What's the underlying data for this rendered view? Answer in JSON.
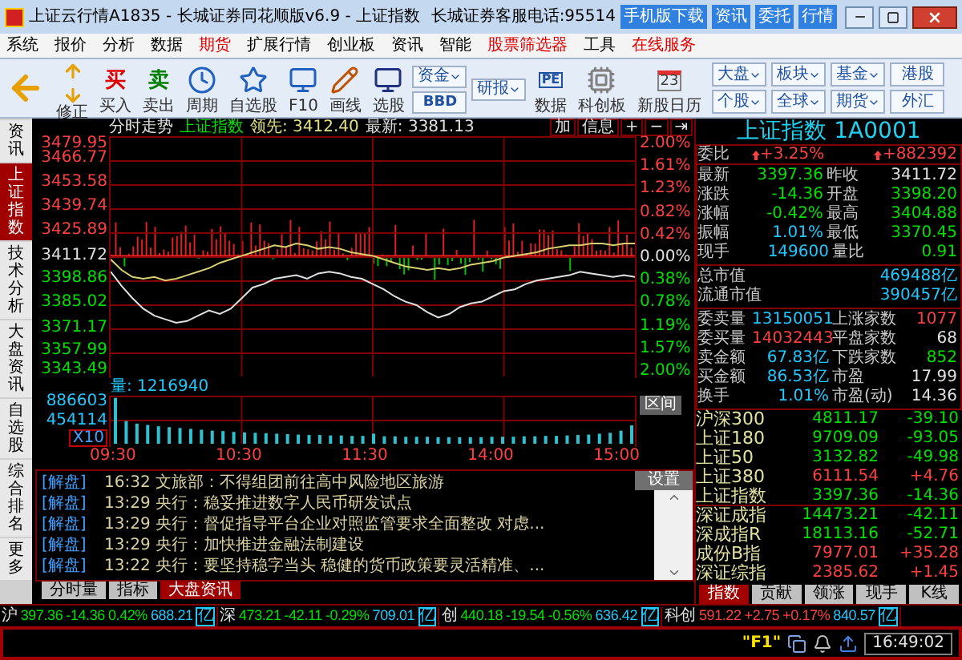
{
  "window": {
    "title": "上证云行情A1835 - 长城证券同花顺版v6.9 - 上证指数",
    "hotline": "长城证券客服电话:95514",
    "buttons": [
      "手机版下载",
      "资讯",
      "委托",
      "行情"
    ]
  },
  "menu": [
    {
      "label": "系统",
      "highlight": false
    },
    {
      "label": "报价",
      "highlight": false
    },
    {
      "label": "分析",
      "highlight": false
    },
    {
      "label": "数据",
      "highlight": false
    },
    {
      "label": "期货",
      "highlight": true
    },
    {
      "label": "扩展行情",
      "highlight": false
    },
    {
      "label": "创业板",
      "highlight": false
    },
    {
      "label": "资讯",
      "highlight": false
    },
    {
      "label": "智能",
      "highlight": false
    },
    {
      "label": "股票筛选器",
      "highlight": true
    },
    {
      "label": "工具",
      "highlight": false
    },
    {
      "label": "在线服务",
      "highlight": true
    }
  ],
  "toolbar": {
    "tools": [
      {
        "kind": "back"
      },
      {
        "kind": "updown",
        "label": "修正"
      },
      {
        "kind": "buy",
        "glyph": "买",
        "label": "买入"
      },
      {
        "kind": "sell",
        "glyph": "卖",
        "label": "卖出"
      },
      {
        "kind": "clock",
        "label": "周期"
      },
      {
        "kind": "folder",
        "label": "自选股"
      },
      {
        "kind": "monitor",
        "label": "F10"
      },
      {
        "kind": "pencil",
        "label": "画线"
      },
      {
        "kind": "screen",
        "label": "选股"
      },
      {
        "kind": "pair",
        "top": "资金",
        "bottom": "BBD"
      },
      {
        "kind": "single",
        "top": "研报"
      },
      {
        "kind": "doc",
        "glyph": "PE",
        "label": "数据"
      },
      {
        "kind": "chip",
        "label": "科创板"
      },
      {
        "kind": "calendar",
        "glyph": "23",
        "label": "新股日历"
      }
    ],
    "markets": [
      {
        "label": "大盘",
        "dropdown": true
      },
      {
        "label": "板块",
        "dropdown": true
      },
      {
        "label": "基金",
        "dropdown": true
      },
      {
        "label": "港股",
        "dropdown": false
      },
      {
        "label": "个股",
        "dropdown": true
      },
      {
        "label": "全球",
        "dropdown": true
      },
      {
        "label": "期货",
        "dropdown": true
      },
      {
        "label": "外汇",
        "dropdown": false
      }
    ]
  },
  "side_tabs": [
    {
      "label": "资讯",
      "selected": false
    },
    {
      "label": "上证指数",
      "selected": true
    },
    {
      "label": "技术分析",
      "selected": false
    },
    {
      "label": "大盘资讯",
      "selected": false
    },
    {
      "label": "自选股",
      "selected": false
    },
    {
      "label": "综合排名",
      "selected": false
    },
    {
      "label": "更多",
      "selected": false
    }
  ],
  "chart": {
    "title": "分时走势",
    "name": "上证指数",
    "lead": "领先: 3412.40",
    "latest": "最新: 3381.13",
    "buttons": [
      "加",
      "信息",
      "+",
      "−",
      "⇥"
    ],
    "chart_data": {
      "type": "line",
      "grid": true,
      "series": [
        {
          "color": "#e0e0e0",
          "values": [
            3403,
            3395,
            3388,
            3382,
            3378,
            3376,
            3374,
            3375,
            3378,
            3381,
            3379,
            3382,
            3388,
            3394,
            3396,
            3399,
            3400,
            3401,
            3399,
            3402,
            3403,
            3402,
            3400,
            3399,
            3396,
            3393,
            3389,
            3386,
            3384,
            3380,
            3377,
            3379,
            3383,
            3385,
            3386,
            3389,
            3392,
            3393,
            3396,
            3398,
            3399,
            3400,
            3401,
            3403,
            3402,
            3401,
            3400,
            3401,
            3400
          ]
        },
        {
          "color": "#d8d070",
          "values": [
            3410,
            3404,
            3400,
            3399,
            3400,
            3398,
            3399,
            3401,
            3403,
            3405,
            3408,
            3410,
            3412,
            3414,
            3416,
            3418,
            3417,
            3419,
            3418,
            3416,
            3417,
            3416,
            3414,
            3413,
            3412,
            3410,
            3408,
            3406,
            3405,
            3404,
            3405,
            3404,
            3405,
            3407,
            3408,
            3409,
            3411,
            3412,
            3413,
            3414,
            3416,
            3417,
            3418,
            3418,
            3419,
            3419,
            3418,
            3419,
            3419
          ]
        }
      ],
      "ylim": [
        3343.49,
        3479.95
      ],
      "yticks": [
        3479.95,
        3466.77,
        3453.58,
        3439.74,
        3425.89,
        3411.72,
        3398.86,
        3385.02,
        3371.17,
        3357.99,
        3343.49
      ]
    },
    "pct_labels": [
      {
        "text": "2.00%",
        "color": "#ff4040"
      },
      {
        "text": "1.61%",
        "color": "#ff4040"
      },
      {
        "text": "1.23%",
        "color": "#ff4040"
      },
      {
        "text": "0.82%",
        "color": "#ff4040"
      },
      {
        "text": "0.42%",
        "color": "#ff4040"
      },
      {
        "text": "0.00%",
        "color": "#e0e0e0"
      },
      {
        "text": "0.38%",
        "color": "#00e000"
      },
      {
        "text": "0.78%",
        "color": "#00e000"
      },
      {
        "text": "1.19%",
        "color": "#00e000"
      },
      {
        "text": "1.57%",
        "color": "#00e000"
      },
      {
        "text": "2.00%",
        "color": "#00e000"
      }
    ],
    "volume": {
      "label": "量: 1216940",
      "scale": "X10",
      "range_button": "区间",
      "chart_data": {
        "type": "bar",
        "grid": true,
        "values": [
          1050000,
          520000,
          460000,
          430000,
          400000,
          380000,
          360000,
          340000,
          320000,
          300000,
          290000,
          270000,
          260000,
          250000,
          240000,
          230000,
          220000,
          210000,
          200000,
          200000,
          190000,
          190000,
          180000,
          180000,
          230000,
          170000,
          170000,
          160000,
          160000,
          160000,
          150000,
          150000,
          150000,
          150000,
          150000,
          160000,
          160000,
          160000,
          170000,
          170000,
          180000,
          180000,
          190000,
          200000,
          210000,
          230000,
          250000,
          300000,
          420000
        ],
        "ylim": [
          0,
          1100000
        ],
        "yticks": [
          886603,
          454114
        ]
      },
      "time_labels": [
        "09:30",
        "10:30",
        "11:30",
        "14:00",
        "15:00"
      ]
    }
  },
  "quote": {
    "title": "上证指数 1A0001",
    "ratio_label": "委比",
    "ratio": "+3.25%",
    "ratio_diff": "+882392",
    "rows": [
      [
        {
          "label": "最新",
          "value": "3397.36",
          "color": "#00e000"
        },
        {
          "label": "昨收",
          "value": "3411.72",
          "color": "#e0e0e0"
        }
      ],
      [
        {
          "label": "涨跌",
          "value": "-14.36",
          "color": "#00e000"
        },
        {
          "label": "开盘",
          "value": "3398.20",
          "color": "#00e000"
        }
      ],
      [
        {
          "label": "涨幅",
          "value": "-0.42%",
          "color": "#00e000"
        },
        {
          "label": "最高",
          "value": "3404.88",
          "color": "#00e000"
        }
      ],
      [
        {
          "label": "振幅",
          "value": "1.01%",
          "color": "#20c8ff"
        },
        {
          "label": "最低",
          "value": "3370.45",
          "color": "#00e000"
        }
      ],
      [
        {
          "label": "现手",
          "value": "149600",
          "color": "#20c8ff"
        },
        {
          "label": "量比",
          "value": "0.91",
          "color": "#00e000"
        }
      ]
    ],
    "caps": [
      {
        "label": "总市值",
        "value": "469488",
        "unit": "亿"
      },
      {
        "label": "流通市值",
        "value": "390457",
        "unit": "亿"
      }
    ],
    "orders": [
      [
        {
          "label": "委卖量",
          "value": "13150051",
          "color": "#20c8ff"
        },
        {
          "label": "上涨家数",
          "value": "1077",
          "color": "#ff4040"
        }
      ],
      [
        {
          "label": "委买量",
          "value": "14032443",
          "color": "#ff4040"
        },
        {
          "label": "平盘家数",
          "value": "68",
          "color": "#e0e0e0"
        }
      ],
      [
        {
          "label": "卖金额",
          "value": "67.83亿",
          "color": "#20c8ff"
        },
        {
          "label": "下跌家数",
          "value": "852",
          "color": "#00e000"
        }
      ],
      [
        {
          "label": "买金额",
          "value": "86.53亿",
          "color": "#20c8ff"
        },
        {
          "label": "市盈",
          "value": "17.99",
          "color": "#e0e0e0"
        }
      ],
      [
        {
          "label": "换手",
          "value": "1.01%",
          "color": "#20c8ff"
        },
        {
          "label": "市盈(动)",
          "value": "14.36",
          "color": "#e0e0e0"
        }
      ]
    ],
    "indices": [
      {
        "name": "沪深300",
        "value": "4811.17",
        "change": "-39.10",
        "color": "#00e000"
      },
      {
        "name": "上证180",
        "value": "9709.09",
        "change": "-93.05",
        "color": "#00e000"
      },
      {
        "name": "上证50",
        "value": "3132.82",
        "change": "-49.98",
        "color": "#00e000"
      },
      {
        "name": "上证380",
        "value": "6111.54",
        "change": "+4.76",
        "color": "#ff4040"
      },
      {
        "name": "上证指数",
        "value": "3397.36",
        "change": "-14.36",
        "color": "#00e000"
      },
      {
        "name": "深证成指",
        "value": "14473.21",
        "change": "-42.11",
        "color": "#00e000"
      },
      {
        "name": "深成指R",
        "value": "18113.16",
        "change": "-52.71",
        "color": "#00e000"
      },
      {
        "name": "成份B指",
        "value": "7977.01",
        "change": "+35.28",
        "color": "#ff4040"
      },
      {
        "name": "深证综指",
        "value": "2385.62",
        "change": "+1.45",
        "color": "#ff4040"
      }
    ],
    "tabs": [
      {
        "label": "指数",
        "selected": true
      },
      {
        "label": "贡献",
        "selected": false
      },
      {
        "label": "领涨",
        "selected": false
      },
      {
        "label": "现手",
        "selected": false
      },
      {
        "label": "K线",
        "selected": false
      }
    ]
  },
  "news": {
    "settings": "设置",
    "items": [
      {
        "tag": "[解盘]",
        "time": "16:32",
        "text": "文旅部：不得组团前往高中风险地区旅游"
      },
      {
        "tag": "[解盘]",
        "time": "13:29",
        "text": "央行：稳妥推进数字人民币研发试点"
      },
      {
        "tag": "[解盘]",
        "time": "13:29",
        "text": "央行：督促指导平台企业对照监管要求全面整改 对虑..."
      },
      {
        "tag": "[解盘]",
        "time": "13:29",
        "text": "央行：加快推进金融法制建设"
      },
      {
        "tag": "[解盘]",
        "time": "13:22",
        "text": "央行：要坚持稳字当头 稳健的货币政策要灵活精准、..."
      }
    ],
    "tabs": [
      {
        "label": "分时量",
        "selected": false
      },
      {
        "label": "指标",
        "selected": false
      },
      {
        "label": "大盘资讯",
        "selected": true
      }
    ]
  },
  "ticker": [
    {
      "market": "沪",
      "price": "397.36",
      "change": "-14.36",
      "pct": "0.42%",
      "amount": "688.21",
      "unit": "亿",
      "color": "#00e000"
    },
    {
      "market": "深",
      "price": "473.21",
      "change": "-42.11",
      "pct": "-0.29%",
      "amount": "709.01",
      "unit": "亿",
      "color": "#00e000"
    },
    {
      "market": "创",
      "price": "440.18",
      "change": "-19.54",
      "pct": "-0.56%",
      "amount": "636.42",
      "unit": "亿",
      "color": "#00e000"
    },
    {
      "market": "科创",
      "price": "591.22",
      "change": "+2.75",
      "pct": "+0.17%",
      "amount": "840.57",
      "unit": "亿",
      "color": "#ff4040"
    }
  ],
  "status_bar": {
    "help": "\"F1\"",
    "time": "16:49:02"
  }
}
